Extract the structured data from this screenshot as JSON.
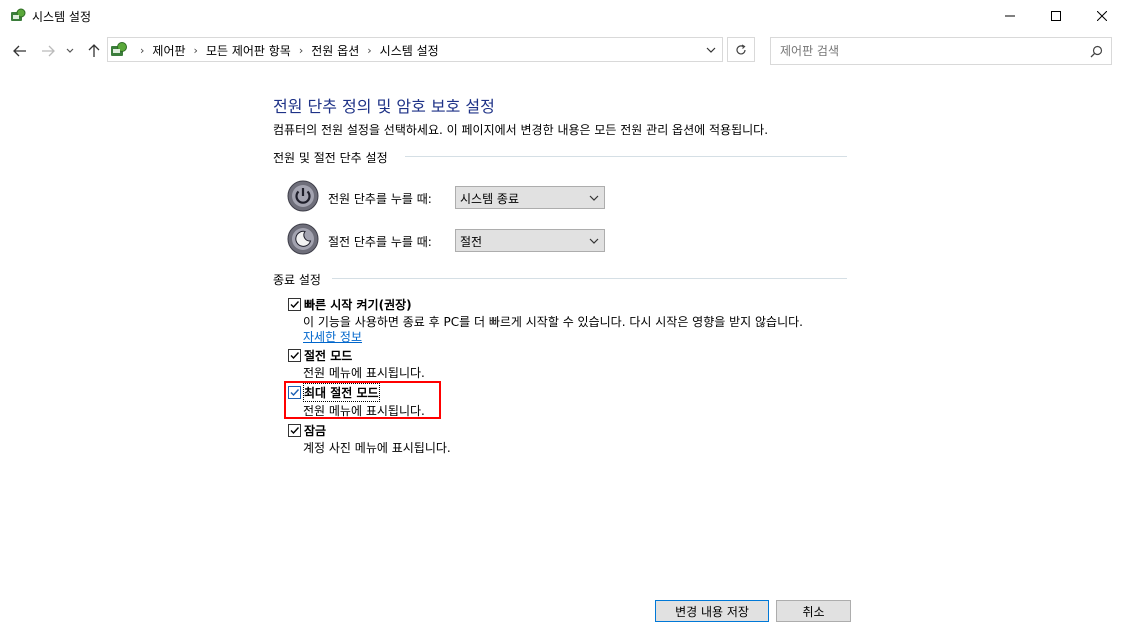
{
  "window": {
    "title": "시스템 설정",
    "icons": {
      "app": "control-panel-icon",
      "minimize": "minimize-icon",
      "maximize": "maximize-icon",
      "close": "close-icon"
    }
  },
  "nav": {
    "breadcrumbs": [
      "제어판",
      "모든 제어판 항목",
      "전원 옵션",
      "시스템 설정"
    ],
    "search_placeholder": "제어판 검색"
  },
  "main": {
    "heading": "전원 단추 정의 및 암호 보호 설정",
    "description": "컴퓨터의 전원 설정을 선택하세요. 이 페이지에서 변경한 내용은 모든 전원 관리 옵션에 적용됩니다.",
    "power_section": {
      "title": "전원 및 절전 단추 설정",
      "power_button": {
        "label": "전원 단추를 누를 때:",
        "value": "시스템 종료"
      },
      "sleep_button": {
        "label": "절전 단추를 누를 때:",
        "value": "절전"
      }
    },
    "shutdown_section": {
      "title": "종료 설정",
      "options": [
        {
          "title": "빠른 시작 켜기(권장)",
          "desc": "이 기능을 사용하면 종료 후 PC를 더 빠르게 시작할 수 있습니다. 다시 시작은 영향을 받지 않습니다.",
          "link": "자세한 정보",
          "checked": true
        },
        {
          "title": "절전 모드",
          "desc": "전원 메뉴에 표시됩니다.",
          "checked": true
        },
        {
          "title": "최대 절전 모드",
          "desc": "전원 메뉴에 표시됩니다.",
          "checked": true
        },
        {
          "title": "잠금",
          "desc": "계정 사진 메뉴에 표시됩니다.",
          "checked": true
        }
      ]
    }
  },
  "footer": {
    "save_label": "변경 내용 저장",
    "cancel_label": "취소"
  },
  "colors": {
    "heading": "#1e3287",
    "link": "#0066cc",
    "highlight": "#ff0000"
  }
}
